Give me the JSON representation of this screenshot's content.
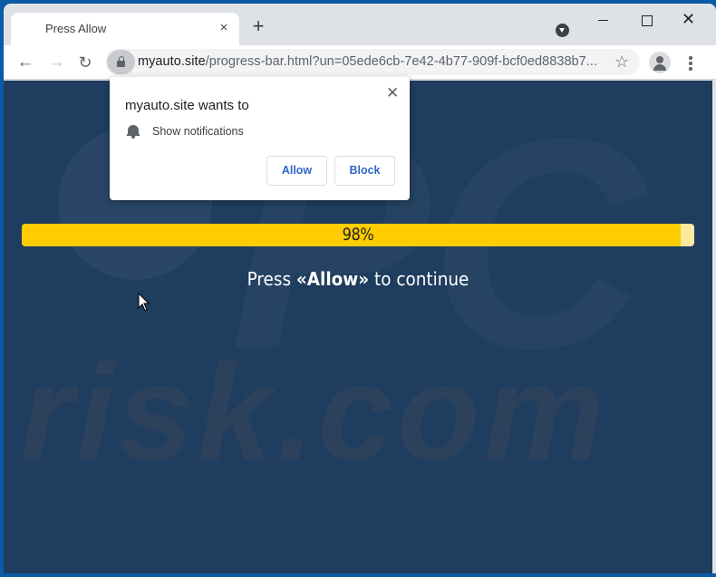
{
  "browser": {
    "tab": {
      "title": "Press Allow",
      "close_label": "×"
    },
    "new_tab_label": "+",
    "window_controls": {
      "close_label": "✕"
    },
    "toolbar": {
      "back_icon": "←",
      "forward_icon": "→",
      "reload_icon": "↻",
      "url_host": "myauto.site",
      "url_rest": "/progress-bar.html?un=05ede6cb-7e42-4b77-909f-bcf0ed8838b7...",
      "star_icon": "☆"
    }
  },
  "permission_popup": {
    "title": "myauto.site wants to",
    "permission": "Show notifications",
    "close_label": "✕",
    "allow_label": "Allow",
    "block_label": "Block"
  },
  "page": {
    "progress": {
      "percent": 98,
      "label": "98%",
      "fill_color": "#ffcc00",
      "track_color": "#fde9a0"
    },
    "cta": {
      "before": "Press ",
      "emphasis": "«Allow»",
      "after": " to continue"
    },
    "background_color": "#1f3d5e",
    "watermark": {
      "text_main": "PC",
      "text_sub": "risk.com"
    }
  }
}
